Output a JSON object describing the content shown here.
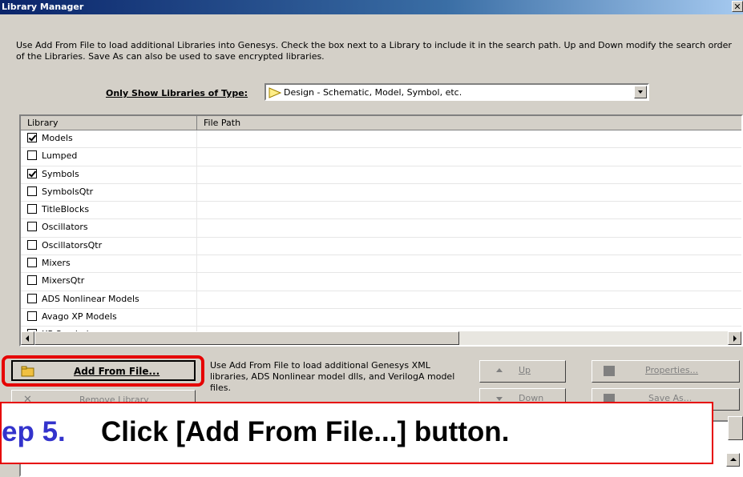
{
  "window": {
    "title": "Library Manager",
    "close_glyph": "✕"
  },
  "intro": "Use Add From File to load additional Libraries into Genesys.  Check the box next to a Library to include it in the search path.  Up and Down modify the search order of the Libraries.  Save As can also be used to save encrypted libraries.",
  "filter": {
    "label": "Only Show Libraries of Type:",
    "selected": "Design - Schematic, Model, Symbol, etc."
  },
  "table": {
    "headers": [
      "Library",
      "File Path"
    ],
    "rows": [
      {
        "name": "Models",
        "checked": true,
        "path": ""
      },
      {
        "name": "Lumped",
        "checked": false,
        "path": ""
      },
      {
        "name": "Symbols",
        "checked": true,
        "path": ""
      },
      {
        "name": "SymbolsQtr",
        "checked": false,
        "path": ""
      },
      {
        "name": "TitleBlocks",
        "checked": false,
        "path": ""
      },
      {
        "name": "Oscillators",
        "checked": false,
        "path": ""
      },
      {
        "name": "OscillatorsQtr",
        "checked": false,
        "path": ""
      },
      {
        "name": "Mixers",
        "checked": false,
        "path": ""
      },
      {
        "name": "MixersQtr",
        "checked": false,
        "path": ""
      },
      {
        "name": "ADS Nonlinear Models",
        "checked": false,
        "path": ""
      },
      {
        "name": "Avago XP Models",
        "checked": false,
        "path": ""
      },
      {
        "name": "XP Symbols",
        "checked": false,
        "path": ""
      }
    ]
  },
  "buttons": {
    "add_from_file": "Add From File...",
    "remove_library": "Remove Library",
    "up": "Up",
    "down": "Down",
    "properties": "Properties...",
    "save_as": "Save As..."
  },
  "help_text": "Use Add From File to load additional Genesys XML libraries, ADS Nonlinear model dlls, and VerilogA model files.",
  "callout": {
    "step": "ep 5.",
    "instruction": "Click [Add From File...] button."
  },
  "colors": {
    "highlight": "#e60000",
    "step": "#3333cc"
  }
}
